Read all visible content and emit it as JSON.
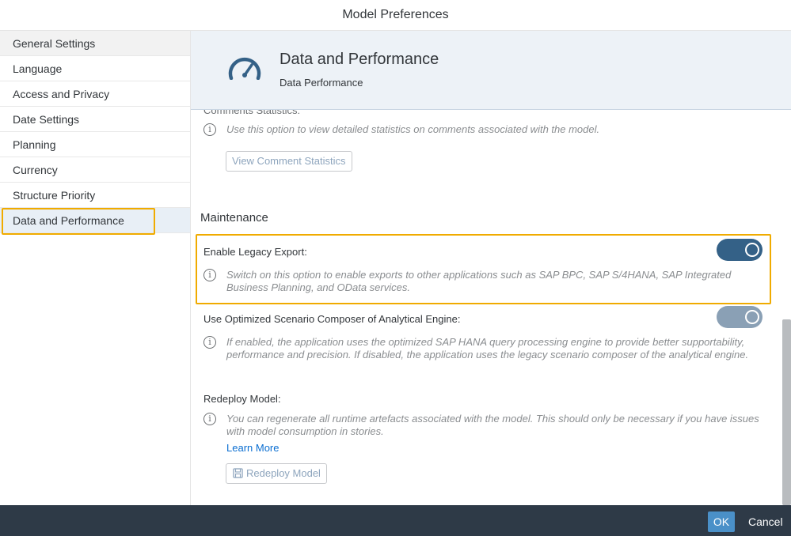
{
  "dialog": {
    "title": "Model Preferences"
  },
  "sidebar": {
    "items": [
      {
        "label": "General Settings"
      },
      {
        "label": "Language"
      },
      {
        "label": "Access and Privacy"
      },
      {
        "label": "Date Settings"
      },
      {
        "label": "Planning"
      },
      {
        "label": "Currency"
      },
      {
        "label": "Structure Priority"
      },
      {
        "label": "Data and Performance"
      }
    ]
  },
  "header": {
    "icon": "gauge-icon",
    "title": "Data and Performance",
    "subtitle": "Data Performance"
  },
  "content": {
    "comments": {
      "label": "Comments Statistics:",
      "description": "Use this option to view detailed statistics on comments associated with the model.",
      "button": "View Comment Statistics"
    },
    "maintenance": {
      "title": "Maintenance"
    },
    "legacy_export": {
      "label": "Enable Legacy Export:",
      "description": "Switch on this option to enable exports to other applications such as SAP BPC, SAP S/4HANA, SAP Integrated Business Planning, and OData services.",
      "enabled": true
    },
    "optimized_composer": {
      "label": "Use Optimized Scenario Composer of Analytical Engine:",
      "description": "If enabled, the application uses the optimized SAP HANA query processing engine to provide better supportability, performance and precision. If disabled, the application uses the legacy scenario composer of the analytical engine.",
      "enabled": true
    },
    "redeploy": {
      "label": "Redeploy Model:",
      "description": "You can regenerate all runtime artefacts associated with the model. This should only be necessary if you have issues with model consumption in stories.",
      "link": "Learn More",
      "button": "Redeploy Model"
    }
  },
  "footer": {
    "ok": "OK",
    "cancel": "Cancel"
  },
  "colors": {
    "highlight": "#f0ab00",
    "toggle_on": "#346187",
    "footer": "#2e3a47",
    "link": "#0a6ed1"
  }
}
